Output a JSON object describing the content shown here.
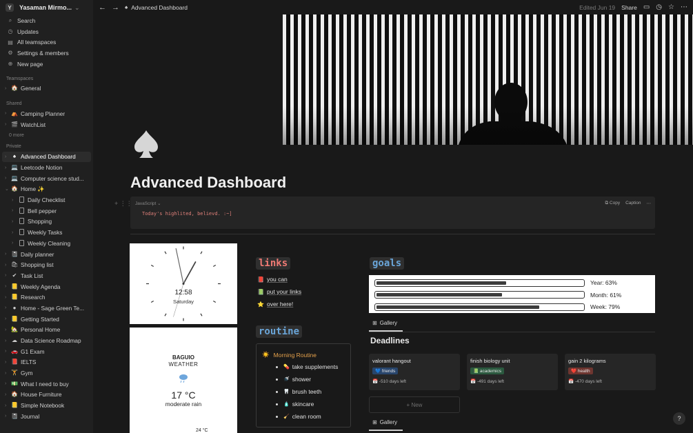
{
  "workspace": {
    "initial": "Y",
    "name": "Yasaman Mirmo..."
  },
  "sidebar": {
    "nav": [
      {
        "icon": "search-icon",
        "glyph": "⌕",
        "label": "Search"
      },
      {
        "icon": "updates-icon",
        "glyph": "◷",
        "label": "Updates"
      },
      {
        "icon": "teamspaces-icon",
        "glyph": "▤",
        "label": "All teamspaces"
      },
      {
        "icon": "gear-icon",
        "glyph": "⚙",
        "label": "Settings & members"
      },
      {
        "icon": "plus-circle-icon",
        "glyph": "⊕",
        "label": "New page"
      }
    ],
    "teamspaces_label": "Teamspaces",
    "teamspaces": [
      {
        "icon": "🏠",
        "label": "General"
      }
    ],
    "shared_label": "Shared",
    "shared": [
      {
        "icon": "⛺",
        "label": "Camping Planner"
      },
      {
        "icon": "🎬",
        "label": "WatchList"
      }
    ],
    "shared_more": "0 more",
    "private_label": "Private",
    "private": [
      {
        "icon": "♠",
        "label": "Advanced Dashboard",
        "active": true
      },
      {
        "icon": "💻",
        "label": "Leetcode Notion"
      },
      {
        "icon": "💻",
        "label": "Computer science stud..."
      },
      {
        "icon": "🏠",
        "label": "Home ✨",
        "expanded": true
      },
      {
        "icon": "doc",
        "label": "Daily Checklist",
        "child": true
      },
      {
        "icon": "doc",
        "label": "Bell pepper",
        "child": true
      },
      {
        "icon": "doc",
        "label": "Shopping",
        "child": true
      },
      {
        "icon": "doc",
        "label": "Weekly Tasks",
        "child": true
      },
      {
        "icon": "doc",
        "label": "Weekly Cleaning",
        "child": true
      },
      {
        "icon": "📓",
        "label": "Daily planner"
      },
      {
        "icon": "🛍",
        "label": "Shopping list"
      },
      {
        "icon": "✔",
        "label": "Task List"
      },
      {
        "icon": "📒",
        "label": "Weekly Agenda"
      },
      {
        "icon": "📒",
        "label": "Research"
      },
      {
        "icon": "●",
        "label": "Home - Sage Green Te..."
      },
      {
        "icon": "📒",
        "label": "Getting Started"
      },
      {
        "icon": "🏡",
        "label": "Personal Home"
      },
      {
        "icon": "☁",
        "label": "Data Science Roadmap"
      },
      {
        "icon": "🚗",
        "label": "G1 Exam"
      },
      {
        "icon": "📕",
        "label": "IELTS"
      },
      {
        "icon": "🏋",
        "label": "Gym"
      },
      {
        "icon": "💵",
        "label": "What I need to buy"
      },
      {
        "icon": "🏠",
        "label": "House Furniture"
      },
      {
        "icon": "📒",
        "label": "Simple Notebook"
      },
      {
        "icon": "📓",
        "label": "Journal"
      }
    ]
  },
  "topbar": {
    "breadcrumb_icon": "♠",
    "breadcrumb": "Advanced Dashboard",
    "edited": "Edited Jun 19",
    "share": "Share"
  },
  "page": {
    "title": "Advanced Dashboard",
    "code": {
      "language": "JavaScript",
      "text": "Today's highlited, believd. :~]",
      "copy": "Copy",
      "caption": "Caption"
    }
  },
  "clock": {
    "time": "12:58",
    "day": "Saturday"
  },
  "weather": {
    "city": "BAGUIO",
    "label": "WEATHER",
    "temp": "17 °C",
    "desc": "moderate rain",
    "forecast_temp": "24 °C"
  },
  "links": {
    "heading": "links",
    "items": [
      {
        "icon": "📕",
        "label": "you can"
      },
      {
        "icon": "📗",
        "label": "put your links"
      },
      {
        "icon": "⭐",
        "label": "over here!"
      }
    ]
  },
  "routine": {
    "heading": "routine",
    "title_icon": "☀️",
    "title": "Morning Routine",
    "items": [
      {
        "icon": "💊",
        "label": "take supplements"
      },
      {
        "icon": "🚿",
        "label": "shower"
      },
      {
        "icon": "🦷",
        "label": "brush teeth"
      },
      {
        "icon": "🧴",
        "label": "skincare"
      },
      {
        "icon": "🧹",
        "label": "clean room"
      }
    ]
  },
  "goals": {
    "heading": "goals",
    "items": [
      {
        "label": "Year: 63%",
        "percent": 63
      },
      {
        "label": "Month: 61%",
        "percent": 61
      },
      {
        "label": "Week: 79%",
        "percent": 79
      }
    ]
  },
  "gallery_tab": "Gallery",
  "deadlines": {
    "heading": "Deadlines",
    "cards": [
      {
        "title": "valorant hangout",
        "tag": "💙 friends",
        "tag_color": "#28456c",
        "days": "📅 -510 days left"
      },
      {
        "title": "finish biology unit",
        "tag": "📗 academics",
        "tag_color": "#2b593f",
        "days": "📅 -491 days left"
      },
      {
        "title": "gain 2 kilograms",
        "tag": "❤️ health",
        "tag_color": "#6e3630",
        "days": "📅 -470 days left"
      }
    ],
    "new_label": "+ New"
  },
  "help": "?"
}
